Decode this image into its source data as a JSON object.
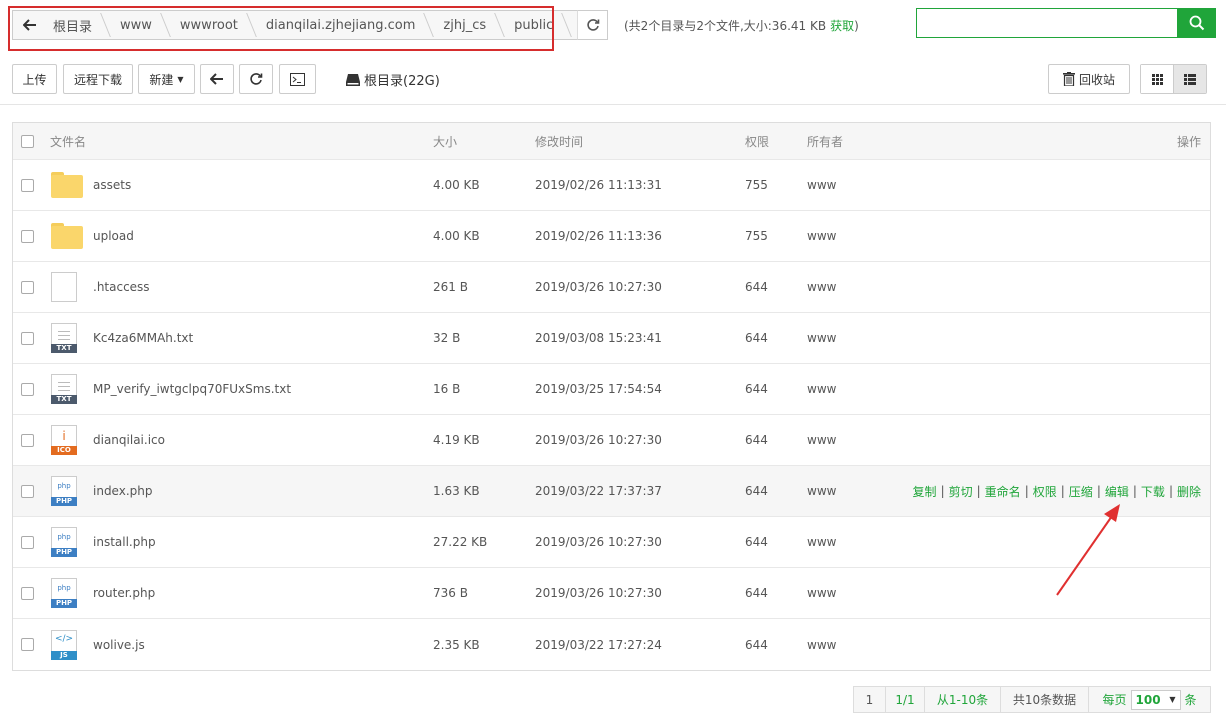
{
  "path": {
    "crumbs": [
      "根目录",
      "www",
      "wwwroot",
      "dianqilai.zjhejiang.com",
      "zjhj_cs",
      "public"
    ],
    "info": "(共2个目录与2个文件,大小:36.41 KB",
    "fetch_label": "获取",
    "info_close": ")"
  },
  "search": {
    "placeholder": ""
  },
  "toolbar": {
    "upload": "上传",
    "remote_download": "远程下载",
    "new": "新建",
    "disk_label": "根目录(22G)",
    "recycle": "回收站"
  },
  "table": {
    "headers": {
      "name": "文件名",
      "size": "大小",
      "mtime": "修改时间",
      "perm": "权限",
      "owner": "所有者",
      "ops": "操作"
    },
    "rows": [
      {
        "name": "assets",
        "size": "4.00 KB",
        "mtime": "2019/02/26 11:13:31",
        "perm": "755",
        "owner": "www",
        "icon": "folder-icon"
      },
      {
        "name": "upload",
        "size": "4.00 KB",
        "mtime": "2019/02/26 11:13:36",
        "perm": "755",
        "owner": "www",
        "icon": "folder-icon"
      },
      {
        "name": ".htaccess",
        "size": "261 B",
        "mtime": "2019/03/26 10:27:30",
        "perm": "644",
        "owner": "www",
        "icon": "file-icon"
      },
      {
        "name": "Kc4za6MMAh.txt",
        "size": "32 B",
        "mtime": "2019/03/08 15:23:41",
        "perm": "644",
        "owner": "www",
        "icon": "txt-file-icon",
        "tag": "TXT"
      },
      {
        "name": "MP_verify_iwtgclpq70FUxSms.txt",
        "size": "16 B",
        "mtime": "2019/03/25 17:54:54",
        "perm": "644",
        "owner": "www",
        "icon": "txt-file-icon",
        "tag": "TXT"
      },
      {
        "name": "dianqilai.ico",
        "size": "4.19 KB",
        "mtime": "2019/03/26 10:27:30",
        "perm": "644",
        "owner": "www",
        "icon": "ico-file-icon",
        "tag": "ICO",
        "glyph": "i"
      },
      {
        "name": "index.php",
        "size": "1.63 KB",
        "mtime": "2019/03/22 17:37:37",
        "perm": "644",
        "owner": "www",
        "icon": "php-file-icon",
        "tag": "PHP",
        "glyph": "php"
      },
      {
        "name": "install.php",
        "size": "27.22 KB",
        "mtime": "2019/03/26 10:27:30",
        "perm": "644",
        "owner": "www",
        "icon": "php-file-icon",
        "tag": "PHP",
        "glyph": "php"
      },
      {
        "name": "router.php",
        "size": "736 B",
        "mtime": "2019/03/26 10:27:30",
        "perm": "644",
        "owner": "www",
        "icon": "php-file-icon",
        "tag": "PHP",
        "glyph": "php"
      },
      {
        "name": "wolive.js",
        "size": "2.35 KB",
        "mtime": "2019/03/22 17:27:24",
        "perm": "644",
        "owner": "www",
        "icon": "js-file-icon",
        "tag": "JS",
        "glyph": "</>"
      }
    ],
    "row_ops": [
      "复制",
      "剪切",
      "重命名",
      "权限",
      "压缩",
      "编辑",
      "下载",
      "删除"
    ]
  },
  "pager": {
    "page": "1",
    "of": "1/1",
    "range": "从1-10条",
    "total": "共10条数据",
    "per_page_label": "每页",
    "per_page_value": "100",
    "per_page_unit": "条"
  },
  "colors": {
    "accent": "#20a53a",
    "highlight": "#d62d2d",
    "txt_tag": "#4c5a6c",
    "ico_tag": "#e36b1f",
    "php_tag": "#3d7fc3",
    "js_tag": "#2f8fc8"
  }
}
